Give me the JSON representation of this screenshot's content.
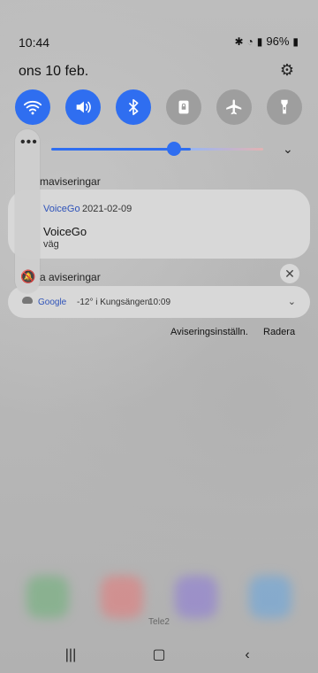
{
  "status": {
    "time": "10:44",
    "battery": "96%",
    "icons": [
      "bluetooth-icon",
      "wifi-icon",
      "volte-icon",
      "signal-icon",
      "battery-icon"
    ]
  },
  "date": "ons 10 feb.",
  "quick_settings": [
    {
      "name": "wifi",
      "icon": "wifi-icon",
      "on": true
    },
    {
      "name": "sound",
      "icon": "speaker-icon",
      "on": true
    },
    {
      "name": "bluetooth",
      "icon": "bluetooth-icon",
      "on": true
    },
    {
      "name": "rotation-lock",
      "icon": "rotation-lock-icon",
      "on": false
    },
    {
      "name": "airplane",
      "icon": "airplane-icon",
      "on": false
    },
    {
      "name": "flashlight",
      "icon": "flashlight-icon",
      "on": false
    }
  ],
  "brightness": {
    "level_percent": 55
  },
  "notifications": {
    "section_1": "maviseringar",
    "voicego": {
      "app": "VoiceGo",
      "date": "2021-02-09",
      "title": "VoiceGo",
      "body": "väg"
    },
    "section_2": "a aviseringar",
    "google": {
      "app": "Google",
      "temp": "-12° i Kungsängen",
      "time": "10:09"
    }
  },
  "actions": {
    "settings": "Aviseringsinställn.",
    "clear": "Radera"
  },
  "carrier": "Tele2",
  "colors": {
    "accent": "#2f6ef0",
    "off": "#9e9e9e",
    "card": "#d8d8d8",
    "link": "#2f53b9"
  }
}
